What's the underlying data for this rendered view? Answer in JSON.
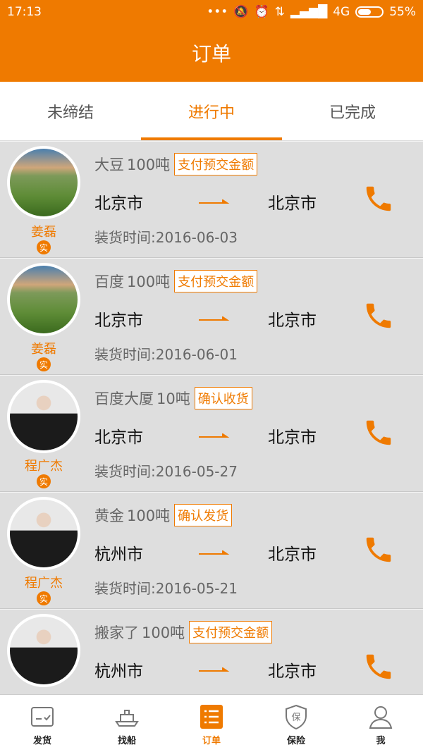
{
  "status": {
    "time": "17:13",
    "network": "4G",
    "battery": "55%",
    "battery_level": 0.55
  },
  "header": {
    "title": "订单"
  },
  "tabs": [
    {
      "label": "未缔结",
      "active": false
    },
    {
      "label": "进行中",
      "active": true
    },
    {
      "label": "已完成",
      "active": false
    }
  ],
  "orders": [
    {
      "user": "姜磊",
      "badge": "实",
      "cargo": "大豆",
      "weight": "100吨",
      "action": "支付预交金额",
      "from": "北京市",
      "to": "北京市",
      "date": "装货时间:2016-06-03",
      "avatar": "scene"
    },
    {
      "user": "姜磊",
      "badge": "实",
      "cargo": "百度",
      "weight": "100吨",
      "action": "支付预交金额",
      "from": "北京市",
      "to": "北京市",
      "date": "装货时间:2016-06-01",
      "avatar": "scene"
    },
    {
      "user": "程广杰",
      "badge": "实",
      "cargo": "百度大厦",
      "weight": "10吨",
      "action": "确认收货",
      "from": "北京市",
      "to": "北京市",
      "date": "装货时间:2016-05-27",
      "avatar": "person"
    },
    {
      "user": "程广杰",
      "badge": "实",
      "cargo": "黄金",
      "weight": "100吨",
      "action": "确认发货",
      "from": "杭州市",
      "to": "北京市",
      "date": "装货时间:2016-05-21",
      "avatar": "person"
    },
    {
      "user": "",
      "badge": "",
      "cargo": "搬家了",
      "weight": "100吨",
      "action": "支付预交金额",
      "from": "杭州市",
      "to": "北京市",
      "date": "",
      "avatar": "person"
    }
  ],
  "bottom_nav": [
    {
      "label": "发货",
      "icon": "ship-goods-icon",
      "active": false
    },
    {
      "label": "找船",
      "icon": "boat-icon",
      "active": false
    },
    {
      "label": "订单",
      "icon": "order-list-icon",
      "active": true
    },
    {
      "label": "保险",
      "icon": "insurance-shield-icon",
      "active": false
    },
    {
      "label": "我",
      "icon": "user-icon",
      "active": false
    }
  ],
  "colors": {
    "accent": "#ef7a00",
    "list_bg": "#dedede"
  }
}
